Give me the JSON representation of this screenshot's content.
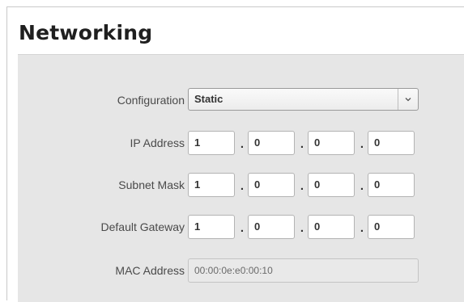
{
  "page": {
    "title": "Networking"
  },
  "form": {
    "configuration": {
      "label": "Configuration",
      "value": "Static"
    },
    "ip_address": {
      "label": "IP Address",
      "octets": [
        "1",
        "0",
        "0",
        "0"
      ]
    },
    "subnet_mask": {
      "label": "Subnet Mask",
      "octets": [
        "1",
        "0",
        "0",
        "0"
      ]
    },
    "default_gateway": {
      "label": "Default Gateway",
      "octets": [
        "1",
        "0",
        "0",
        "0"
      ]
    },
    "mac_address": {
      "label": "MAC Address",
      "value": "00:00:0e:e0:00:10"
    },
    "separator": "."
  },
  "icons": {
    "dropdown": "chevron-down-icon"
  },
  "colors": {
    "panel_background": "#e6e6e6",
    "title_text": "#1f1f1f",
    "label_text": "#4a4a4a"
  }
}
